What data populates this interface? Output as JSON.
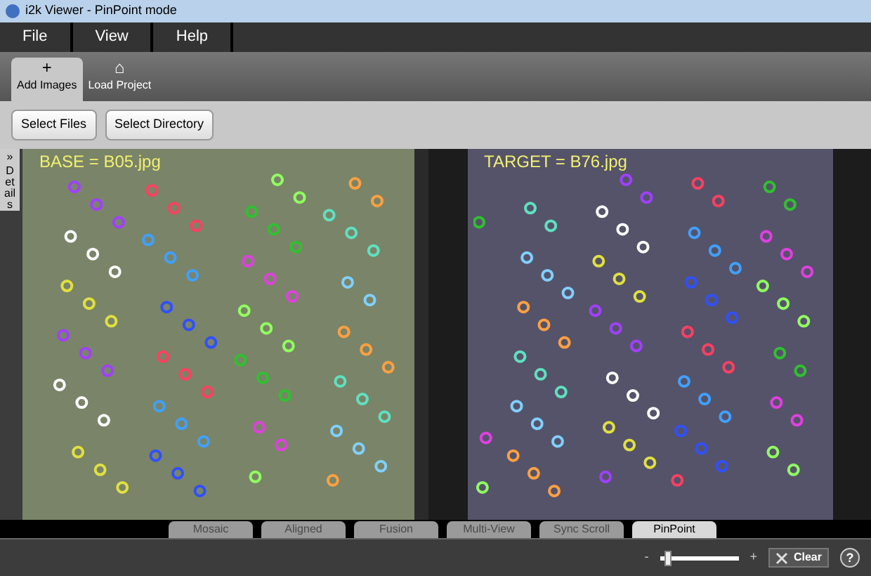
{
  "window": {
    "title": "i2k Viewer - PinPoint mode"
  },
  "menu": [
    "File",
    "View",
    "Help"
  ],
  "toolbar": [
    {
      "label": "Add Images",
      "icon": "+",
      "selected": true
    },
    {
      "label": "Load Project",
      "icon": "⌂",
      "selected": false
    }
  ],
  "buttons": [
    "Select Files",
    "Select Directory"
  ],
  "details_tab": "Details",
  "details_arrow": "»",
  "base_image": {
    "label": "BASE = B05.jpg"
  },
  "target_image": {
    "label": "TARGET = B76.jpg"
  },
  "view_tabs": [
    {
      "label": "Mosaic",
      "disabled": true,
      "selected": false
    },
    {
      "label": "Aligned",
      "disabled": true,
      "selected": false
    },
    {
      "label": "Fusion",
      "disabled": true,
      "selected": false
    },
    {
      "label": "Multi-View",
      "disabled": true,
      "selected": false
    },
    {
      "label": "Sync Scroll",
      "disabled": true,
      "selected": false
    },
    {
      "label": "PinPoint",
      "disabled": false,
      "selected": true
    }
  ],
  "zoom": {
    "minus": "-",
    "plus": "+",
    "level": 0.05
  },
  "clear_button": "Clear",
  "help_button": "?"
}
